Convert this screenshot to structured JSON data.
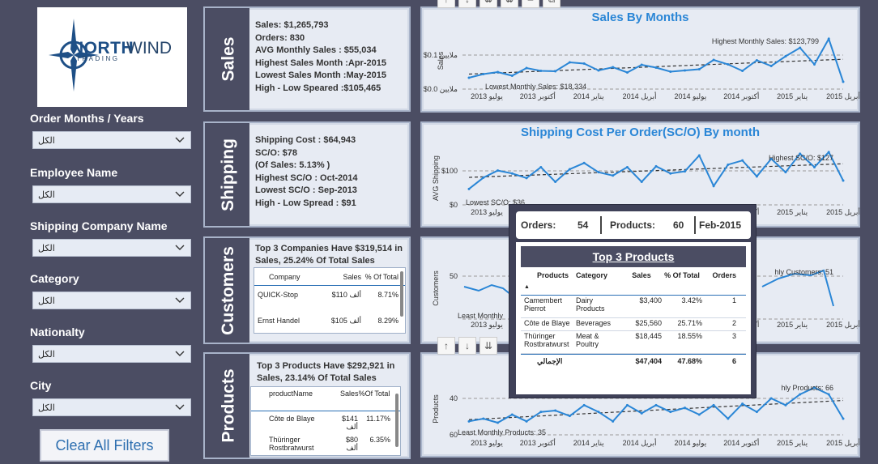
{
  "logo": {
    "north": "NORTH",
    "wind": "WIND",
    "trading": "TRADING"
  },
  "filters": [
    {
      "label": "Order Months / Years",
      "value": "الكل"
    },
    {
      "label": "Employee Name",
      "value": "الكل"
    },
    {
      "label": "Shipping Company Name",
      "value": "الكل"
    },
    {
      "label": "Category",
      "value": "الكل"
    },
    {
      "label": "Nationalty",
      "value": "الكل"
    },
    {
      "label": "City",
      "value": "الكل"
    }
  ],
  "clear_button": "Clear All Filters",
  "sales": {
    "title": "Sales",
    "kpis": [
      "Sales: $1,265,793",
      "Orders: 830",
      "AVG Monthly Sales : $55,034",
      "Highest Sales Month :Apr-2015",
      "Lowest Sales Month :May-2015",
      "High - Low Speared :$105,465"
    ]
  },
  "shipping": {
    "title": "Shipping",
    "kpis": [
      "Shipping Cost : $64,943",
      "SC/O: $78",
      "(Of Sales:  5.13% )",
      "Highest SC/O : Oct-2014",
      "Lowest SC/O : Sep-2013",
      "High - Low Spread : $91"
    ]
  },
  "customers": {
    "title": "Customers",
    "headline": "Top 3 Companies Have $319,514 in Sales, 25.24% Of Total Sales",
    "columns": [
      "Company",
      "Sales",
      "% Of Total"
    ],
    "rows": [
      {
        "company": "QUICK-Stop",
        "sales": "$110 ألف",
        "pct": "8.71%"
      },
      {
        "company": "Ernst Handel",
        "sales": "$105 ألف",
        "pct": "8.29%"
      }
    ]
  },
  "products": {
    "title": "Products",
    "headline": "Top 3 Products Have $292,921 in Sales, 23.14% Of Total Sales",
    "columns": [
      "productName",
      "Sales",
      "%Of Total"
    ],
    "rows": [
      {
        "product": "Côte de Blaye",
        "sales": "$141 ألف",
        "pct": "11.17%"
      },
      {
        "product": "Thüringer Rostbratwurst",
        "sales": "$80 ألف",
        "pct": "6.35%"
      }
    ]
  },
  "x_ticks": [
    "يوليو 2013",
    "أكتوبر 2013",
    "يناير 2014",
    "أبريل 2014",
    "يوليو 2014",
    "أكتوبر 2014",
    "يناير 2015",
    "أبريل 2015"
  ],
  "chart_data": [
    {
      "type": "line",
      "title": "Sales By Months",
      "ylabel": "Sales",
      "y_ticks": [
        "$0.0 ملايين",
        "$0.1 ملايين"
      ],
      "ylim": [
        0,
        0.14
      ],
      "values": [
        0.028,
        0.037,
        0.042,
        0.033,
        0.052,
        0.045,
        0.044,
        0.066,
        0.063,
        0.046,
        0.054,
        0.041,
        0.06,
        0.053,
        0.043,
        0.046,
        0.049,
        0.072,
        0.061,
        0.045,
        0.071,
        0.057,
        0.081,
        0.102,
        0.061,
        0.124,
        0.018
      ],
      "annotations": [
        "Highest Monthly Sales: $123,799",
        "Lowest Monthly Sales: $18,334"
      ]
    },
    {
      "type": "line",
      "title": "Shipping Cost Per Order(SC/O) By month",
      "ylabel": "AVG Shipping",
      "y_ticks": [
        "$0",
        "$100"
      ],
      "ylim": [
        0,
        145
      ],
      "values": [
        38,
        65,
        82,
        75,
        64,
        90,
        55,
        85,
        100,
        78,
        70,
        90,
        55,
        92,
        75,
        80,
        118,
        45,
        96,
        106,
        68,
        110,
        78,
        122,
        90,
        126,
        58
      ],
      "annotations": [
        "Highest SC/O: $127",
        "Lowest SC/O: $36"
      ]
    },
    {
      "type": "line",
      "title": "",
      "ylabel": "Customers",
      "y_ticks": [
        "50"
      ],
      "values": [],
      "annotations": [
        "hly Customers: 51",
        "Least Monthly"
      ]
    },
    {
      "type": "line",
      "title": "",
      "ylabel": "Products",
      "y_ticks": [
        "40",
        "60"
      ],
      "ylim": [
        30,
        72
      ],
      "values": [
        40,
        42,
        39,
        45,
        40,
        47,
        48,
        44,
        52,
        47,
        40,
        52,
        46,
        52,
        47,
        50,
        45,
        52,
        42,
        53,
        47,
        57,
        52,
        60,
        65,
        60,
        42
      ],
      "annotations": [
        "hly Products: 66",
        "Least Monthly Products: 35"
      ]
    }
  ],
  "popup": {
    "orders_label": "Orders:",
    "orders": "54",
    "products_label": "Products:",
    "products": "60",
    "month": "Feb-2015",
    "title": "Top 3 Products",
    "columns": [
      "Products",
      "Category",
      "Sales",
      "% Of Total",
      "Orders"
    ],
    "rows": [
      {
        "product": "Camembert Pierrot",
        "category": "Dairy Products",
        "sales": "$3,400",
        "pct": "3.42%",
        "orders": "1"
      },
      {
        "product": "Côte de Blaye",
        "category": "Beverages",
        "sales": "$25,560",
        "pct": "25.71%",
        "orders": "2"
      },
      {
        "product": "Thüringer Rostbratwurst",
        "category": "Meat & Poultry",
        "sales": "$18,445",
        "pct": "18.55%",
        "orders": "3"
      }
    ],
    "total": {
      "label": "الإجمالي",
      "sales": "$47,404",
      "pct": "47.68%",
      "orders": "6"
    }
  },
  "colors": {
    "line": "#2a86d6",
    "background": "#4b4d63",
    "card": "#e7ebf3"
  }
}
